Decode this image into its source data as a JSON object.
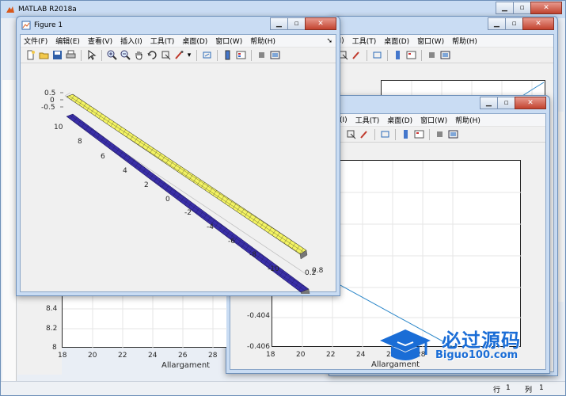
{
  "matlab": {
    "title": "MATLAB R2018a",
    "status": {
      "row_label": "行",
      "row_value": "1",
      "col_label": "列",
      "col_value": "1"
    }
  },
  "figure_back": {
    "menu": [
      "(I)",
      "工具(T)",
      "桌面(D)",
      "窗口(W)",
      "帮助(H)"
    ],
    "yticks": [
      "8.4",
      "8.2",
      "8"
    ],
    "xticks": [
      "18",
      "20",
      "22",
      "24",
      "26",
      "28"
    ],
    "xlabel": "Allargament"
  },
  "figure_mid": {
    "menu": [
      "(I)",
      "工具(T)",
      "桌面(D)",
      "窗口(W)",
      "帮助(H)"
    ],
    "yticks": [
      "-0.404",
      "-0.406"
    ],
    "xticks": [
      "18",
      "20",
      "22",
      "24",
      "26",
      "28"
    ],
    "xlabel": "Allargament"
  },
  "figure1": {
    "title": "Figure 1",
    "menu": [
      "文件(F)",
      "编辑(E)",
      "查看(V)",
      "插入(I)",
      "工具(T)",
      "桌面(D)",
      "窗口(W)",
      "帮助(H)"
    ],
    "zticks": [
      "0.5",
      "0",
      "-0.5"
    ],
    "yticks": [
      "10",
      "8",
      "6",
      "4",
      "2",
      "0",
      "-2",
      "-4",
      "-6",
      "-8",
      "-10"
    ],
    "xticks": [
      "0.8",
      "0.2"
    ],
    "colors": {
      "upper_surface": "#f4f463",
      "lower_surface": "#3a2fa8",
      "grid": "#1a1a1a"
    }
  },
  "watermark": {
    "brand": "必过源码",
    "url": "Biguo100.com"
  }
}
